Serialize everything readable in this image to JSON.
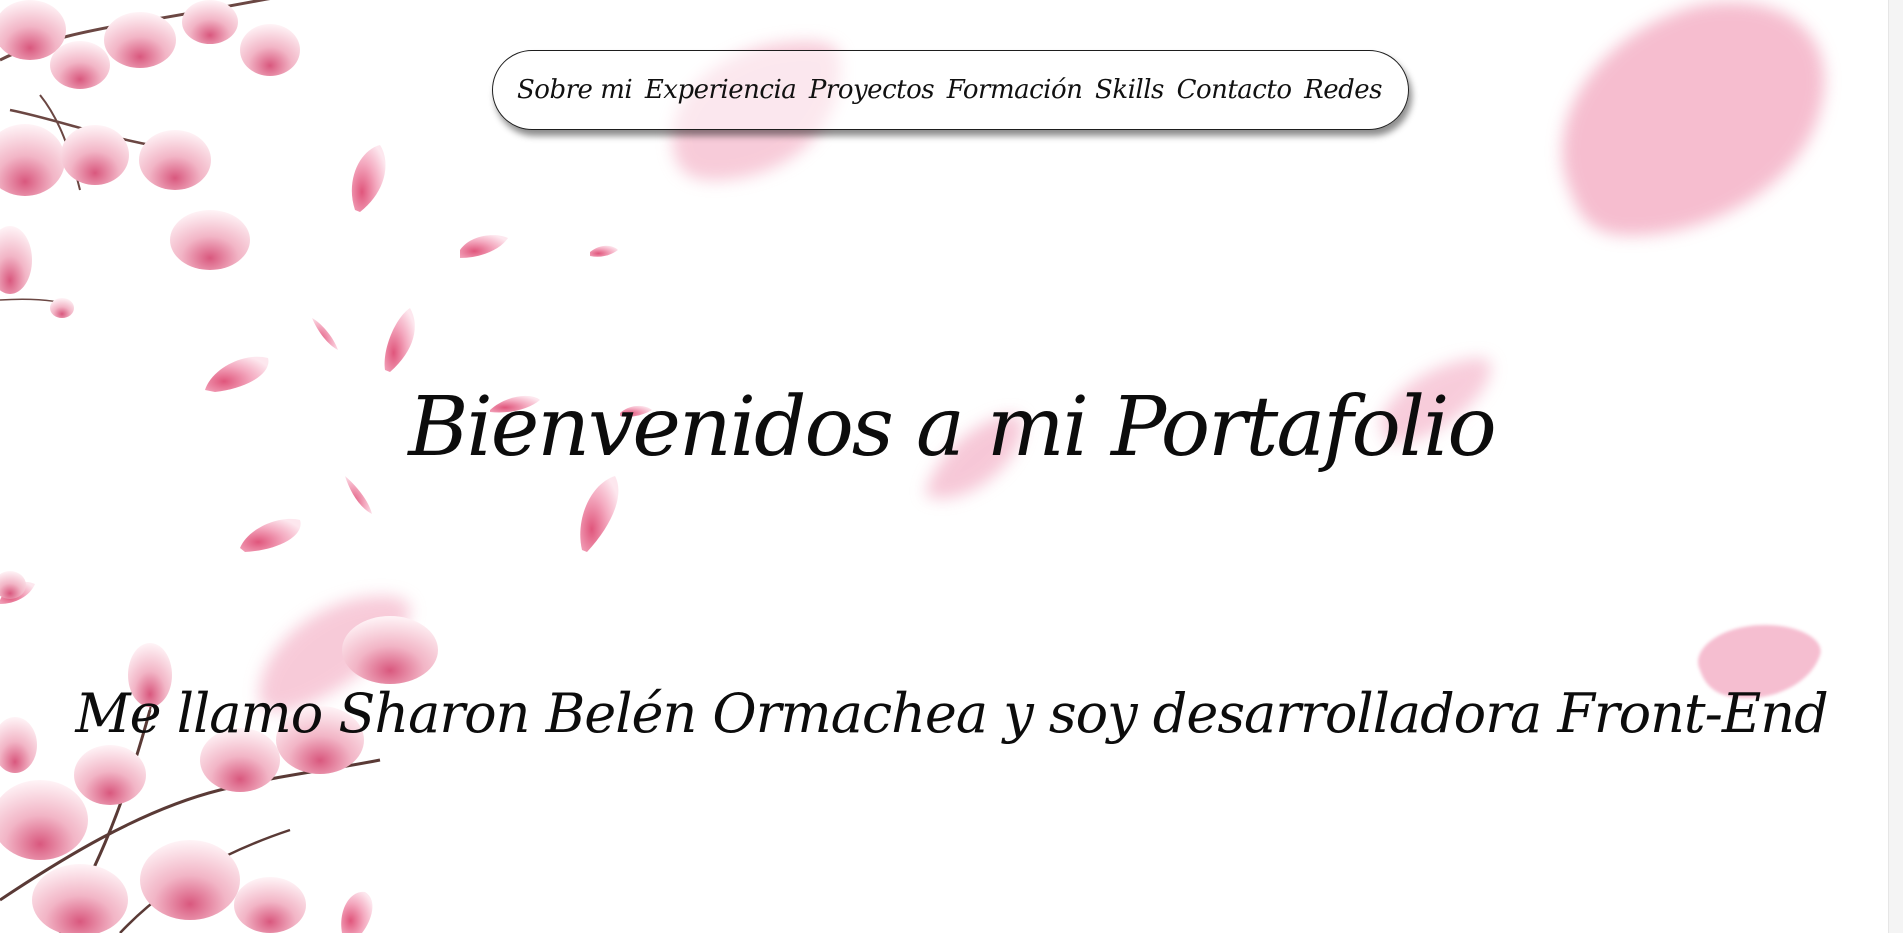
{
  "nav": {
    "items": [
      {
        "label": "Sobre mi"
      },
      {
        "label": "Experiencia"
      },
      {
        "label": "Proyectos"
      },
      {
        "label": "Formación"
      },
      {
        "label": "Skills"
      },
      {
        "label": "Contacto"
      },
      {
        "label": "Redes"
      }
    ]
  },
  "hero": {
    "title": "Bienvenidos a mi Portafolio",
    "subtitle": "Me llamo Sharon Belén Ormachea y soy desarrolladora Front-End"
  },
  "colors": {
    "background": "#ffffff",
    "text": "#0c0c0c",
    "petal": "#f2a3bd",
    "petal_dark": "#e0708f",
    "branch": "#5a3a36"
  },
  "decor": {
    "theme": "magnolia-blossom"
  }
}
